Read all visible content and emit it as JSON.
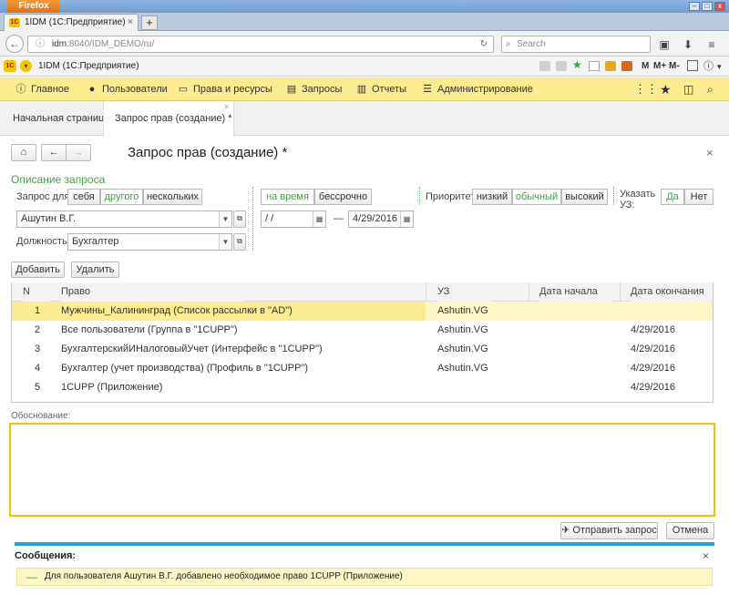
{
  "browser": {
    "menu_label": "Firefox",
    "tab_title": "1IDM (1С:Предприятие)",
    "tab_favicon": "1C",
    "new_tab_symbol": "+",
    "url_host": "idm",
    "url_rest": ":8040/IDM_DEMO/ru/",
    "search_placeholder": "Search"
  },
  "appbar": {
    "favicon": "1C",
    "title": "1IDM  (1С:Предприятие)",
    "m_label": "M",
    "mplus_label": "M+",
    "mminus_label": "M-"
  },
  "menu": {
    "home": "Главное",
    "users": "Пользователи",
    "rights": "Права и ресурсы",
    "requests": "Запросы",
    "reports": "Отчеты",
    "admin": "Администрирование"
  },
  "page_tabs": {
    "start": "Начальная страница",
    "current": "Запрос прав (создание) *"
  },
  "form": {
    "title": "Запрос прав (создание) *",
    "section_title": "Описание запроса",
    "request_for_label": "Запрос для:",
    "for_self": "себя",
    "for_other": "другого",
    "for_several": "нескольких",
    "user_value": "Ашутин В.Г.",
    "position_label": "Должность:",
    "position_value": "Бухгалтер",
    "for_time": "на время",
    "indefinite": "бессрочно",
    "date_from": " /  /",
    "date_dash": "—",
    "date_to": "4/29/2016",
    "priority_label": "Приоритет:",
    "priority_low": "низкий",
    "priority_normal": "обычный",
    "priority_high": "высокий",
    "specify_account_label": "Указать УЗ:",
    "yes": "Да",
    "no": "Нет",
    "add_button": "Добавить",
    "delete_button": "Удалить",
    "justification_label": "Обоснование:",
    "send_button": "Отправить запрос",
    "cancel_button": "Отмена"
  },
  "table": {
    "headers": [
      "N",
      "Право",
      "УЗ",
      "Дата начала",
      "Дата окончания"
    ],
    "rows": [
      {
        "n": "1",
        "right": "Мужчины_Калининград (Список рассылки в \"AD\")",
        "account": "Ashutin.VG",
        "start": "",
        "end": ""
      },
      {
        "n": "2",
        "right": "Все пользователи (Группа в \"1CUPP\")",
        "account": "Ashutin.VG",
        "start": "",
        "end": "4/29/2016"
      },
      {
        "n": "3",
        "right": "БухгалтерскийИНалоговыйУчет (Интерфейс в \"1CUPP\")",
        "account": "Ashutin.VG",
        "start": "",
        "end": "4/29/2016"
      },
      {
        "n": "4",
        "right": "Бухгалтер (учет производства) (Профиль в \"1CUPP\")",
        "account": "Ashutin.VG",
        "start": "",
        "end": "4/29/2016"
      },
      {
        "n": "5",
        "right": "1CUPP (Приложение)",
        "account": "",
        "start": "",
        "end": "4/29/2016"
      }
    ]
  },
  "messages": {
    "title": "Сообщения:",
    "text": "Для пользователя Ашутин В.Г. добавлено необходимое право 1CUPP (Приложение)"
  },
  "colors": {
    "menu_bg": "#fbeb91",
    "accent_green": "#3ea33e",
    "highlight_row": "#fdf7c6",
    "focus_border": "#f2c200",
    "message_bar": "#2d9fd9"
  }
}
